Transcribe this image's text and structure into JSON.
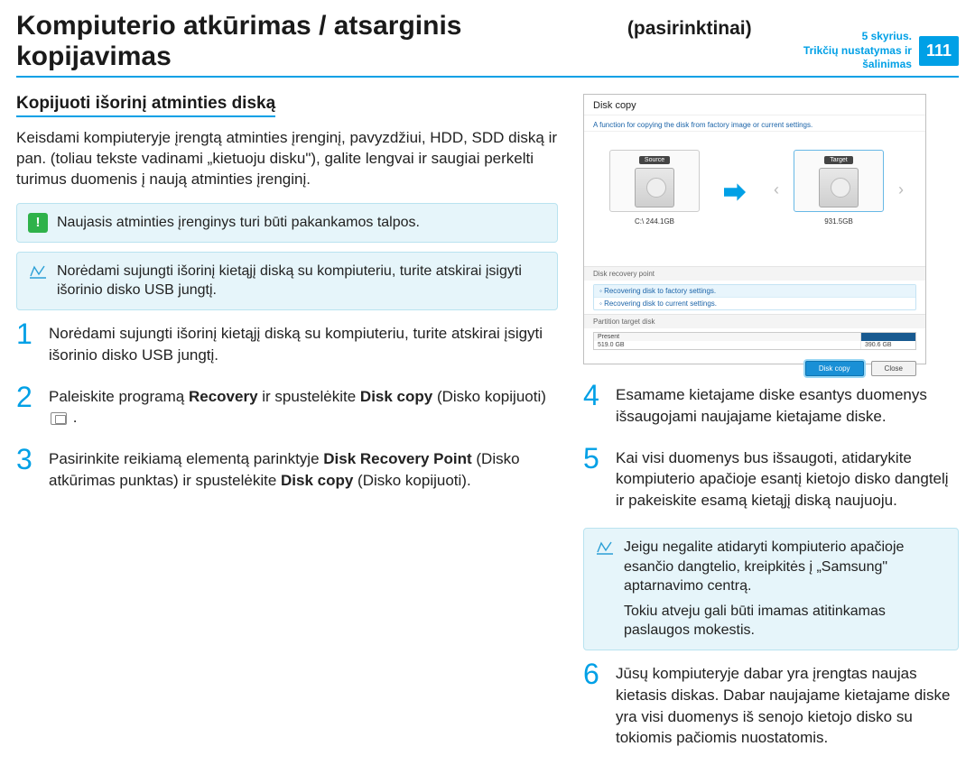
{
  "header": {
    "titleMain": "Kompiuterio atkūrimas / atsarginis kopijavimas",
    "titleSub": "(pasirinktinai)",
    "chapterLine1": "5 skyrius.",
    "chapterLine2": "Trikčių nustatymas ir šalinimas",
    "pageNum": "111"
  },
  "section": {
    "heading": "Kopijuoti išorinį atminties diską",
    "intro": "Keisdami kompiuteryje įrengtą atminties įrenginį, pavyzdžiui, HDD, SDD diską ir pan. (toliau tekste vadinami „kietuoju disku\"), galite lengvai ir saugiai perkelti turimus duomenis į naują atminties įrenginį.",
    "warn": "Naujasis atminties įrenginys turi būti pakankamos talpos.",
    "note": "Norėdami sujungti išorinį kietąjį diską su kompiuteriu, turite atskirai įsigyti išorinio disko USB jungtį."
  },
  "steps": [
    {
      "num": "1",
      "body": "Norėdami sujungti išorinį kietąjį diską su kompiuteriu, turite atskirai įsigyti išorinio disko USB jungtį."
    },
    {
      "num": "2",
      "body_a": "Paleiskite programą ",
      "b1": "Recovery",
      "body_b": " ir spustelėkite ",
      "b2": "Disk copy",
      "body_c": " (Disko kopijuoti) ",
      "body_d": " ."
    },
    {
      "num": "3",
      "body_a": "Pasirinkite reikiamą elementą parinktyje ",
      "b1": "Disk Recovery Point",
      "body_b": " (Disko atkūrimas punktas) ir spustelėkite ",
      "b2": "Disk copy",
      "body_c": " (Disko kopijuoti)."
    },
    {
      "num": "4",
      "body": "Esamame kietajame diske esantys duomenys išsaugojami naujajame kietajame diske."
    },
    {
      "num": "5",
      "body": "Kai visi duomenys bus išsaugoti, atidarykite kompiuterio apačioje esantį kietojo disko dangtelį ir pakeiskite esamą kietąjį diską naujuoju."
    },
    {
      "num": "6",
      "body": "Jūsų kompiuteryje dabar yra įrengtas naujas kietasis diskas. Dabar naujajame kietajame diske yra visi duomenys iš senojo kietojo disko su tokiomis pačiomis nuostatomis."
    }
  ],
  "note2": {
    "line1": "Jeigu negalite atidaryti kompiuterio apačioje esančio dangtelio, kreipkitės į „Samsung\" aptarnavimo centrą.",
    "line2": "Tokiu atveju gali būti imamas atitinkamas paslaugos mokestis."
  },
  "shot": {
    "title": "Disk copy",
    "desc": "A function for copying the disk from factory image or current settings.",
    "sourceLabel": "Source",
    "targetLabel": "Target",
    "sourceCap": "C:\\ 244.1GB",
    "targetCap": "931.5GB",
    "recoveryHeader": "Disk recovery point",
    "recov1": "Recovering disk to factory settings.",
    "recov2": "Recovering disk to current settings.",
    "partitionHeader": "Partition target disk",
    "partPresent": "Present",
    "partCap1": "519.0 GB",
    "partCap2": "390.6 GB",
    "btnPrimary": "Disk copy",
    "btnClose": "Close"
  }
}
